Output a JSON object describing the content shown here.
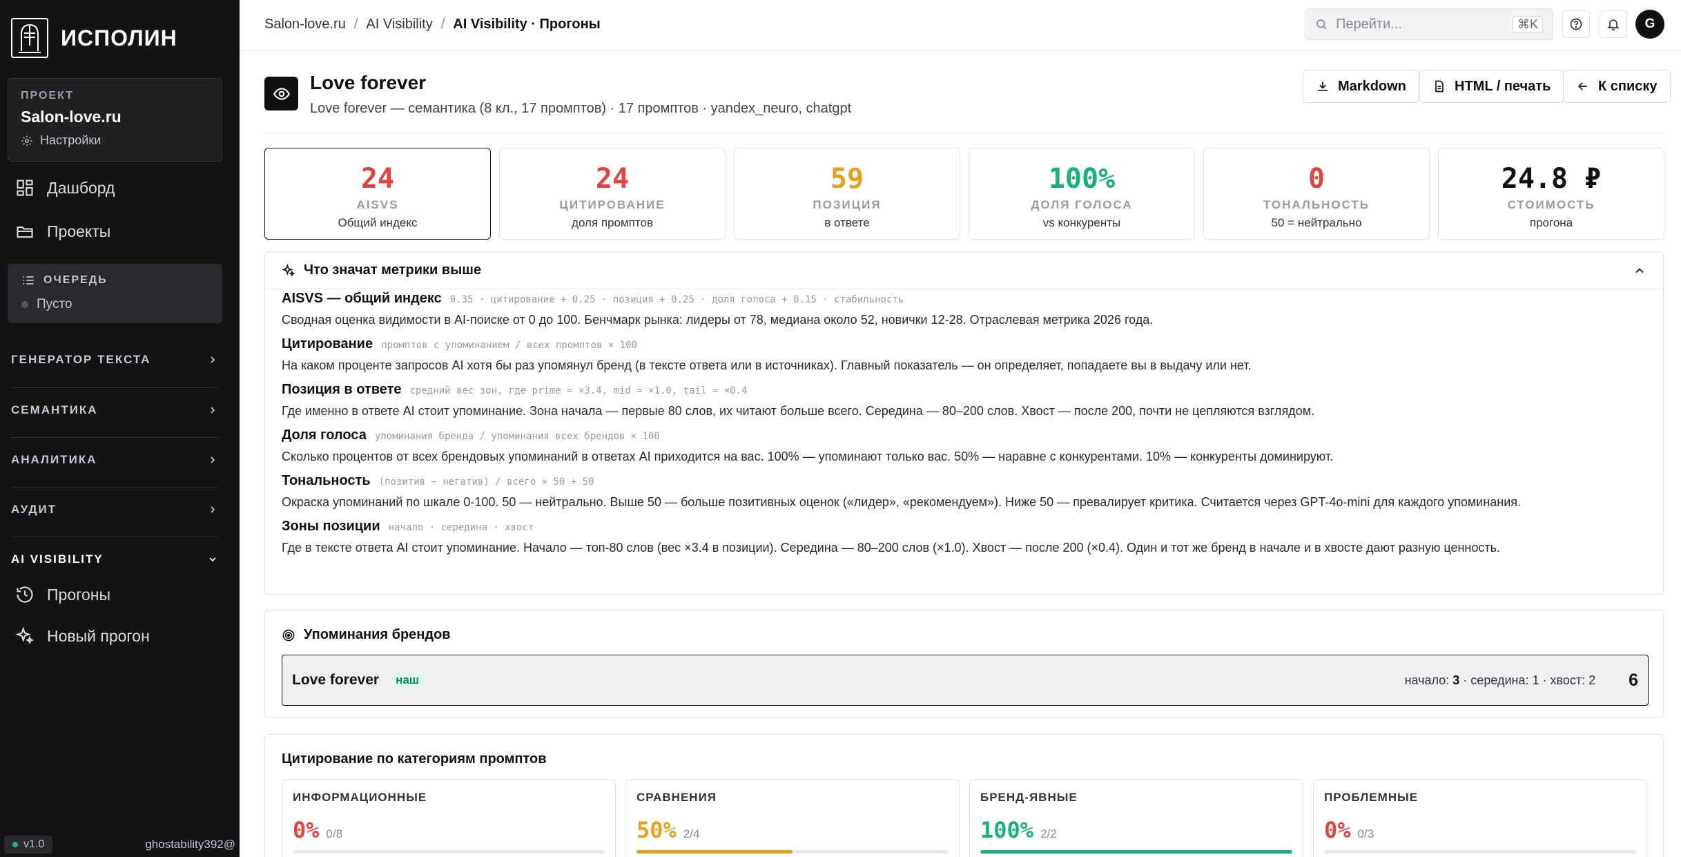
{
  "sidebar": {
    "logo_text": "ИСПОЛИН",
    "project": {
      "label": "ПРОЕКТ",
      "name": "Salon-love.ru",
      "settings": "Настройки"
    },
    "nav": [
      {
        "label": "Дашборд",
        "icon": "dashboard-icon"
      },
      {
        "label": "Проекты",
        "icon": "folder-icon"
      }
    ],
    "queue": {
      "title": "ОЧЕРЕДЬ",
      "status": "Пусто"
    },
    "sections": [
      {
        "label": "ГЕНЕРАТОР ТЕКСТА",
        "expanded": false
      },
      {
        "label": "СЕМАНТИКА",
        "expanded": false
      },
      {
        "label": "АНАЛИТИКА",
        "expanded": false
      },
      {
        "label": "АУДИТ",
        "expanded": false
      },
      {
        "label": "AI VISIBILITY",
        "expanded": true
      }
    ],
    "ai_items": [
      {
        "label": "Прогоны",
        "icon": "history-icon"
      },
      {
        "label": "Новый прогон",
        "icon": "sparkles-icon"
      }
    ],
    "footer": {
      "version": "v1.0",
      "user": "ghostability392@"
    }
  },
  "topbar": {
    "breadcrumb": [
      "Salon-love.ru",
      "AI Visibility",
      "AI Visibility · Прогоны"
    ],
    "separator": "/",
    "search_placeholder": "Перейти...",
    "search_shortcut": "⌘K",
    "avatar_initial": "G"
  },
  "header": {
    "title": "Love forever",
    "subtitle": "Love forever — семантика (8 кл., 17 промптов) · 17 промптов · yandex_neuro, chatgpt",
    "buttons": {
      "markdown": "Markdown",
      "html": "HTML / печать",
      "back": "К списку"
    }
  },
  "metrics": [
    {
      "value": "24",
      "label": "AISVS",
      "note": "Общий индекс",
      "color": "#e0443e",
      "selected": true
    },
    {
      "value": "24",
      "label": "ЦИТИРОВАНИЕ",
      "note": "доля промптов",
      "color": "#e0443e",
      "selected": false
    },
    {
      "value": "59",
      "label": "ПОЗИЦИЯ",
      "note": "в ответе",
      "color": "#e6a01e",
      "selected": false
    },
    {
      "value": "100%",
      "label": "ДОЛЯ ГОЛОСА",
      "note": "vs конкуренты",
      "color": "#17b27a",
      "selected": false
    },
    {
      "value": "0",
      "label": "ТОНАЛЬНОСТЬ",
      "note": "50 = нейтрально",
      "color": "#e0443e",
      "selected": false
    },
    {
      "value": "24.8 ₽",
      "label": "СТОИМОСТЬ",
      "note": "прогона",
      "color": "#111111",
      "selected": false
    }
  ],
  "explain": {
    "title": "Что значат метрики выше",
    "items": [
      {
        "name": "AISVS — общий индекс",
        "formula": "0.35 · цитирование + 0.25 · позиция + 0.25 · доля голоса + 0.15 · стабильность",
        "desc": "Сводная оценка видимости в AI-поиске от 0 до 100. Бенчмарк рынка: лидеры от 78, медиана около 52, новички 12-28. Отраслевая метрика 2026 года."
      },
      {
        "name": "Цитирование",
        "formula": "промптов с упоминанием / всех промптов × 100",
        "desc": "На каком проценте запросов AI хотя бы раз упомянул бренд (в тексте ответа или в источниках). Главный показатель — он определяет, попадаете вы в выдачу или нет."
      },
      {
        "name": "Позиция в ответе",
        "formula": "средний вес зон, где prime = ×3.4, mid = ×1.0, tail = ×0.4",
        "desc": "Где именно в ответе AI стоит упоминание. Зона начала — первые 80 слов, их читают больше всего. Середина — 80–200 слов. Хвост — после 200, почти не цепляются взглядом."
      },
      {
        "name": "Доля голоса",
        "formula": "упоминания бренда / упоминания всех брендов × 100",
        "desc": "Сколько процентов от всех брендовых упоминаний в ответах AI приходится на вас. 100% — упоминают только вас. 50% — наравне с конкурентами. 10% — конкуренты доминируют."
      },
      {
        "name": "Тональность",
        "formula": "(позитив − негатив) / всего × 50 + 50",
        "desc": "Окраска упоминаний по шкале 0-100. 50 — нейтрально. Выше 50 — больше позитивных оценок («лидер», «рекомендуем»). Ниже 50 — превалирует критика. Считается через GPT-4o-mini для каждого упоминания."
      },
      {
        "name": "Зоны позиции",
        "formula": "начало · середина · хвост",
        "desc": "Где в тексте ответа AI стоит упоминание. Начало — топ-80 слов (вес ×3.4 в позиции). Середина — 80–200 слов (×1.0). Хвост — после 200 (×0.4). Один и тот же бренд в начале и в хвосте дают разную ценность."
      }
    ]
  },
  "mentions": {
    "title": "Упоминания брендов",
    "brand": {
      "name": "Love forever",
      "tag": "наш",
      "zones_start_label": "начало:",
      "zones_start_value": "3",
      "zones_rest": "· середина: 1 · хвост: 2",
      "count": "6"
    }
  },
  "categories": {
    "title": "Цитирование по категориям промптов",
    "items": [
      {
        "label": "ИНФОРМАЦИОННЫЕ",
        "value": "0%",
        "fraction": "0/8",
        "ratio": 0,
        "color": "#e0443e"
      },
      {
        "label": "СРАВНЕНИЯ",
        "value": "50%",
        "fraction": "2/4",
        "ratio": 0.5,
        "color": "#e6a01e"
      },
      {
        "label": "БРЕНД-ЯВНЫЕ",
        "value": "100%",
        "fraction": "2/2",
        "ratio": 1,
        "color": "#17b27a"
      },
      {
        "label": "ПРОБЛЕМНЫЕ",
        "value": "0%",
        "fraction": "0/3",
        "ratio": 0,
        "color": "#e0443e"
      }
    ]
  }
}
